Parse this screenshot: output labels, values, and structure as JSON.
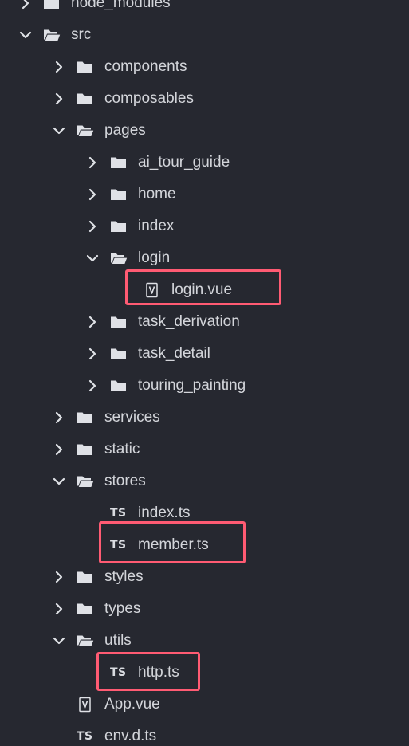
{
  "tree": {
    "colors": {
      "background": "#262830",
      "text": "#d3d5da",
      "icon": "#dfe1e6",
      "highlight": "#ff5b73"
    },
    "items": [
      {
        "label": "node_modules",
        "kind": "folder",
        "state": "collapsed",
        "depth": 0,
        "highlighted": false
      },
      {
        "label": "src",
        "kind": "folder",
        "state": "expanded",
        "depth": 0,
        "highlighted": false
      },
      {
        "label": "components",
        "kind": "folder",
        "state": "collapsed",
        "depth": 1,
        "highlighted": false
      },
      {
        "label": "composables",
        "kind": "folder",
        "state": "collapsed",
        "depth": 1,
        "highlighted": false
      },
      {
        "label": "pages",
        "kind": "folder",
        "state": "expanded",
        "depth": 1,
        "highlighted": false
      },
      {
        "label": "ai_tour_guide",
        "kind": "folder",
        "state": "collapsed",
        "depth": 2,
        "highlighted": false
      },
      {
        "label": "home",
        "kind": "folder",
        "state": "collapsed",
        "depth": 2,
        "highlighted": false
      },
      {
        "label": "index",
        "kind": "folder",
        "state": "collapsed",
        "depth": 2,
        "highlighted": false
      },
      {
        "label": "login",
        "kind": "folder",
        "state": "expanded",
        "depth": 2,
        "highlighted": false
      },
      {
        "label": "login.vue",
        "kind": "vue-file",
        "depth": 3,
        "highlighted": true
      },
      {
        "label": "task_derivation",
        "kind": "folder",
        "state": "collapsed",
        "depth": 2,
        "highlighted": false
      },
      {
        "label": "task_detail",
        "kind": "folder",
        "state": "collapsed",
        "depth": 2,
        "highlighted": false
      },
      {
        "label": "touring_painting",
        "kind": "folder",
        "state": "collapsed",
        "depth": 2,
        "highlighted": false
      },
      {
        "label": "services",
        "kind": "folder",
        "state": "collapsed",
        "depth": 1,
        "highlighted": false
      },
      {
        "label": "static",
        "kind": "folder",
        "state": "collapsed",
        "depth": 1,
        "highlighted": false
      },
      {
        "label": "stores",
        "kind": "folder",
        "state": "expanded",
        "depth": 1,
        "highlighted": false
      },
      {
        "label": "index.ts",
        "kind": "ts-file",
        "icon_text": "TS",
        "depth": 2,
        "highlighted": false
      },
      {
        "label": "member.ts",
        "kind": "ts-file",
        "icon_text": "TS",
        "depth": 2,
        "highlighted": true
      },
      {
        "label": "styles",
        "kind": "folder",
        "state": "collapsed",
        "depth": 1,
        "highlighted": false
      },
      {
        "label": "types",
        "kind": "folder",
        "state": "collapsed",
        "depth": 1,
        "highlighted": false
      },
      {
        "label": "utils",
        "kind": "folder",
        "state": "expanded",
        "depth": 1,
        "highlighted": false
      },
      {
        "label": "http.ts",
        "kind": "ts-file",
        "icon_text": "TS",
        "depth": 2,
        "highlighted": true
      },
      {
        "label": "App.vue",
        "kind": "vue-file",
        "depth": 1,
        "highlighted": false
      },
      {
        "label": "env.d.ts",
        "kind": "ts-file",
        "icon_text": "TS",
        "depth": 1,
        "highlighted": false
      }
    ]
  }
}
